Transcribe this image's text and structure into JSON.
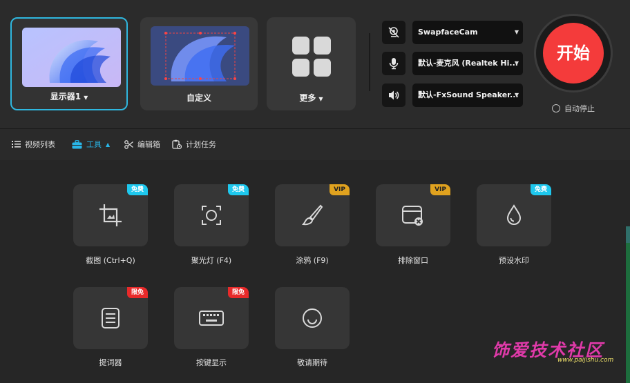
{
  "capture_modes": [
    {
      "label": "显示器1",
      "has_caret": true
    },
    {
      "label": "自定义",
      "has_caret": false
    },
    {
      "label": "更多",
      "has_caret": true
    }
  ],
  "devices": {
    "camera": {
      "icon": "webcam-disabled-icon",
      "value": "SwapfaceCam"
    },
    "microphone": {
      "icon": "microphone-icon",
      "value": "默认-麦克风 (Realtek Hi..."
    },
    "speaker": {
      "icon": "speaker-icon",
      "value": "默认-FxSound Speaker..."
    }
  },
  "start_button": {
    "label": "开始",
    "color": "#f43b3b"
  },
  "auto_stop": {
    "label": "自动停止",
    "checked": false
  },
  "toolbar": {
    "video_list": "视频列表",
    "tools": "工具",
    "editor": "编辑箱",
    "schedule": "计划任务"
  },
  "tools": [
    {
      "label": "截图 (Ctrl+Q)",
      "badge": "免费",
      "badge_type": "free",
      "icon": "screenshot-crop-icon"
    },
    {
      "label": "聚光灯 (F4)",
      "badge": "免费",
      "badge_type": "free",
      "icon": "spotlight-icon"
    },
    {
      "label": "涂鸦 (F9)",
      "badge": "VIP",
      "badge_type": "vip",
      "icon": "brush-icon"
    },
    {
      "label": "排除窗口",
      "badge": "VIP",
      "badge_type": "vip",
      "icon": "exclude-window-icon"
    },
    {
      "label": "预设水印",
      "badge": "免费",
      "badge_type": "free",
      "icon": "watermark-drop-icon"
    },
    {
      "label": "提词器",
      "badge": "限免",
      "badge_type": "limited",
      "icon": "teleprompter-icon"
    },
    {
      "label": "按键显示",
      "badge": "限免",
      "badge_type": "limited",
      "icon": "keyboard-icon"
    },
    {
      "label": "敬请期待",
      "badge": "",
      "badge_type": "",
      "icon": "loading-circle-icon"
    }
  ],
  "watermark": {
    "text": "饰爱技术社区",
    "url": "www.paijishu.com"
  },
  "colors": {
    "accent": "#29b6e8",
    "selected_border": "#2fb8e0",
    "free_badge": "#1ec8ee",
    "vip_badge": "#e0a21f",
    "limited_badge": "#e82a2a"
  }
}
